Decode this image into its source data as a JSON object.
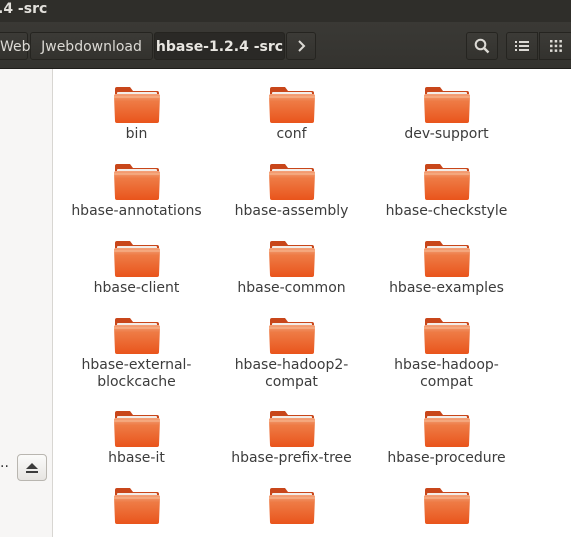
{
  "window": {
    "title": ".4 -src"
  },
  "breadcrumb": {
    "items": [
      "Web",
      "Jwebdownload",
      "hbase-1.2.4 -src"
    ],
    "current": "hbase-1.2.4 -src"
  },
  "toolbar": {
    "search_icon": "search-icon",
    "list_icon": "list-view-icon",
    "grid_icon": "grid-view-icon",
    "forward_icon": "chevron-right-icon"
  },
  "sidebar": {
    "truncated_label": "..",
    "eject_icon": "eject-icon"
  },
  "folder_color": "#e9541b",
  "files": [
    {
      "name": "bin"
    },
    {
      "name": "conf"
    },
    {
      "name": "dev-support"
    },
    {
      "name": "hbase-annotations"
    },
    {
      "name": "hbase-assembly"
    },
    {
      "name": "hbase-checkstyle"
    },
    {
      "name": "hbase-client"
    },
    {
      "name": "hbase-common"
    },
    {
      "name": "hbase-examples"
    },
    {
      "name": "hbase-external-\nblockcache"
    },
    {
      "name": "hbase-hadoop2-\ncompat"
    },
    {
      "name": "hbase-hadoop-\ncompat"
    },
    {
      "name": "hbase-it"
    },
    {
      "name": "hbase-prefix-tree"
    },
    {
      "name": "hbase-procedure"
    },
    {
      "name": ""
    },
    {
      "name": ""
    },
    {
      "name": ""
    }
  ]
}
